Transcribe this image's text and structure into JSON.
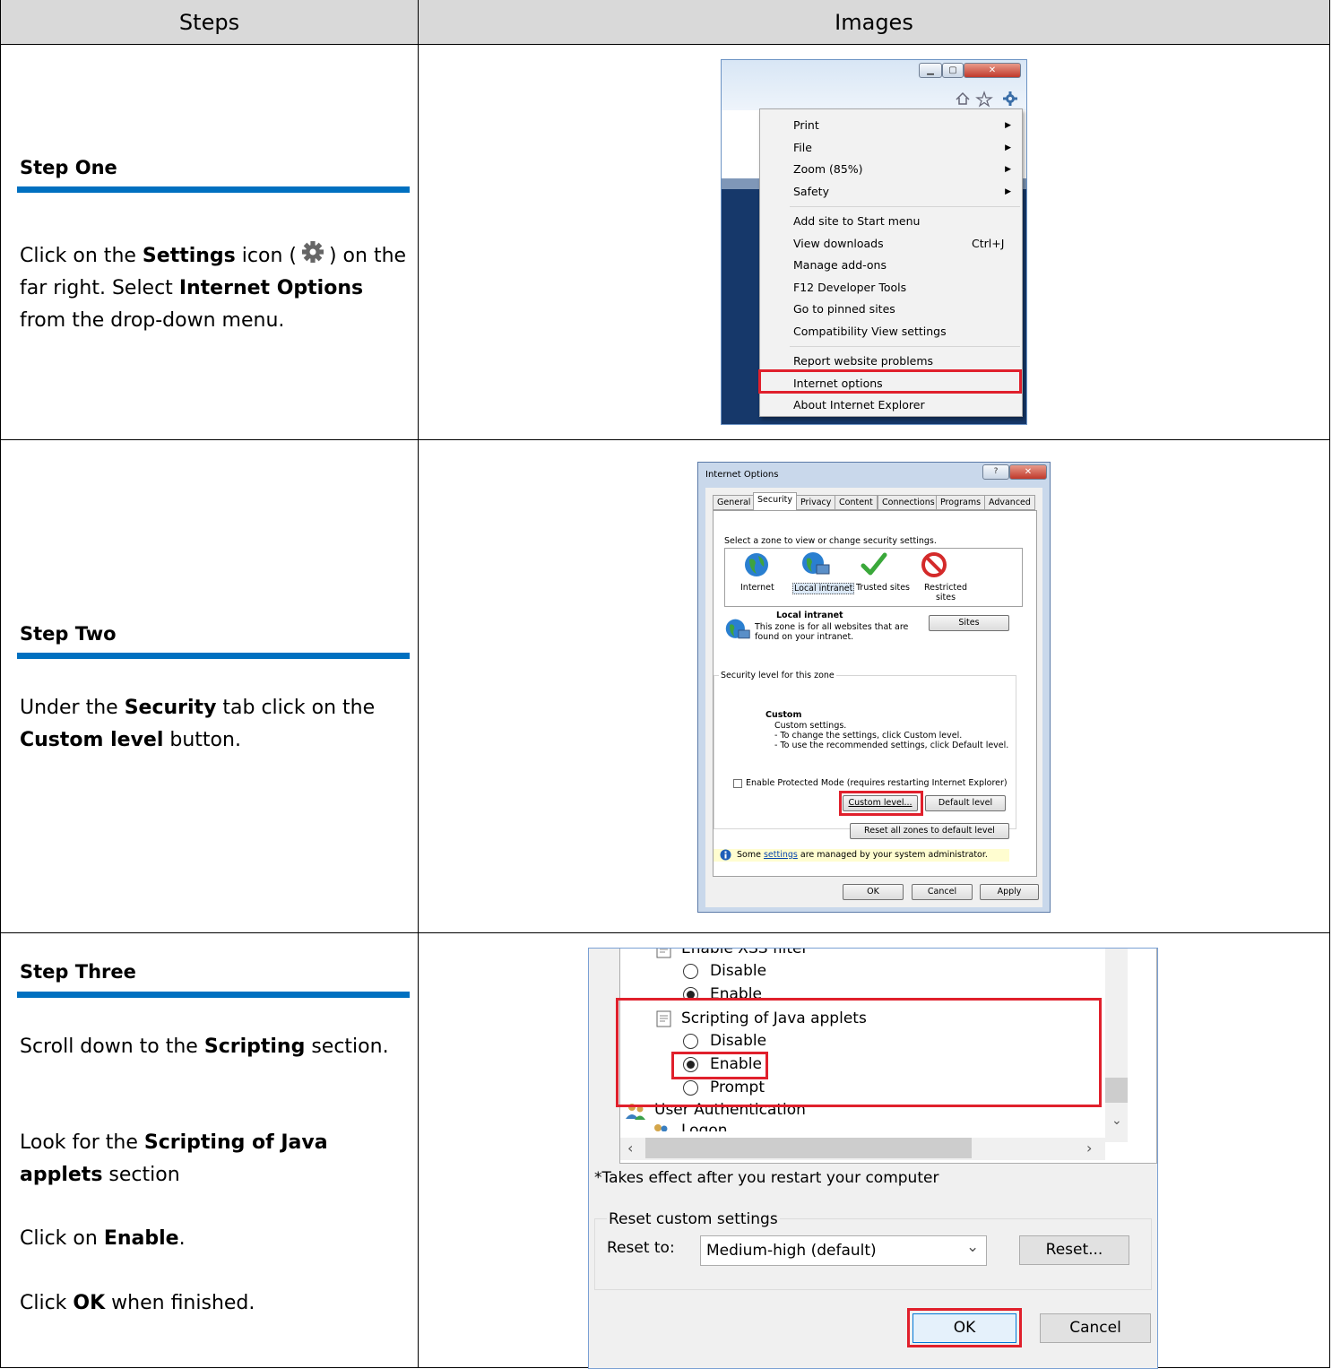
{
  "header": {
    "steps": "Steps",
    "images": "Images"
  },
  "step_one": {
    "title": "Step One",
    "desc": {
      "p1": "Click on the ",
      "b1": "Settings",
      "p2": " icon (",
      "p3": ") on the far right. Select ",
      "b2": "Internet Options",
      "p4": " from the drop-down menu."
    },
    "menu": {
      "items": [
        "Print",
        "File",
        "Zoom (85%)",
        "Safety",
        "Add site to Start menu",
        "View downloads",
        "Manage add-ons",
        "F12 Developer Tools",
        "Go to pinned sites",
        "Compatibility View settings",
        "Report website problems",
        "Internet options",
        "About Internet Explorer"
      ],
      "shortcut": "Ctrl+J"
    }
  },
  "step_two": {
    "title": "Step Two",
    "desc": {
      "p1": "Under the ",
      "b1": "Security",
      "p2": " tab click on the ",
      "b2": "Custom level",
      "p3": " button."
    },
    "dialog": {
      "title": "Internet Options",
      "tabs": [
        "General",
        "Security",
        "Privacy",
        "Content",
        "Connections",
        "Programs",
        "Advanced"
      ],
      "select_zone": "Select a zone to view or change security settings.",
      "zones": [
        "Internet",
        "Local intranet",
        "Trusted sites",
        "Restricted sites"
      ],
      "zone_title": "Local intranet",
      "zone_desc1": "This zone is for all websites that are",
      "zone_desc2": "found on your intranet.",
      "sites": "Sites",
      "security_level": "Security level for this zone",
      "custom": "Custom",
      "custom1": "Custom settings.",
      "custom2": "- To change the settings, click Custom level.",
      "custom3": "- To use the recommended settings, click Default level.",
      "protected": "Enable Protected Mode (requires restarting Internet Explorer)",
      "custom_level": "Custom level...",
      "default_level": "Default level",
      "reset_all": "Reset all zones to default level",
      "notice_pre": "Some ",
      "notice_link": "settings",
      "notice_post": " are managed by your system administrator.",
      "ok": "OK",
      "cancel": "Cancel",
      "apply": "Apply"
    }
  },
  "step_three": {
    "title": "Step Three",
    "desc": {
      "l1a": "Scroll down to the ",
      "l1b": "Scripting",
      "l1c": " section.",
      "l2a": "Look for the ",
      "l2b": "Scripting of Java applets",
      "l2c": " section",
      "l3a": "Click on ",
      "l3b": "Enable",
      "l3c": ".",
      "l4a": "Click ",
      "l4b": "OK",
      "l4c": " when finished."
    },
    "dialog": {
      "xss": "Enable XSS filter",
      "disable1": "Disable",
      "enable1": "Enable",
      "scripting": "Scripting of Java applets",
      "disable2": "Disable",
      "enable2": "Enable",
      "prompt": "Prompt",
      "user_auth": "User Authentication",
      "logon": "Logon",
      "takes_effect": "*Takes effect after you restart your computer",
      "reset_custom": "Reset custom settings",
      "reset_to": "Reset to:",
      "reset_value": "Medium-high (default)",
      "reset_btn": "Reset...",
      "ok": "OK",
      "cancel": "Cancel"
    }
  },
  "colors": {
    "accent_bar": "#0070c0",
    "highlight": "#e0202c",
    "header_bg": "#d9d9d9"
  }
}
